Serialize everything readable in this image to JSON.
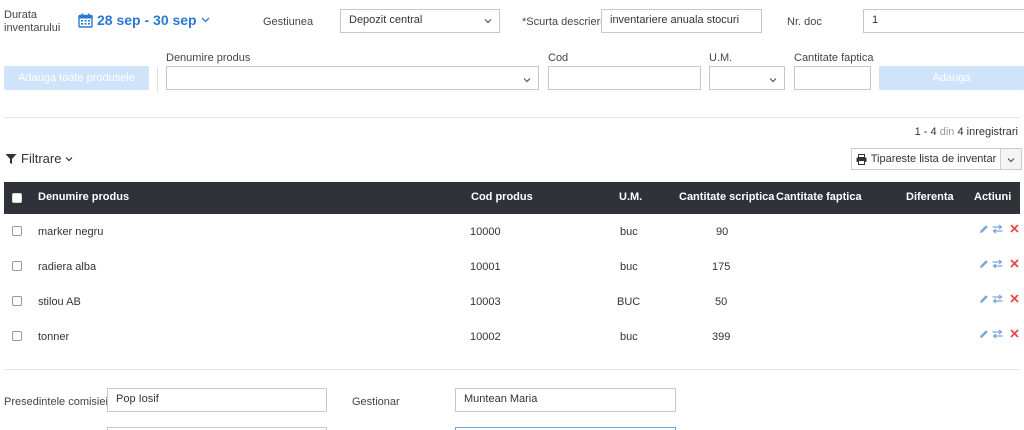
{
  "header": {
    "duration_label_1": "Durata",
    "duration_label_2": "inventarului",
    "date_range": "28 sep - 30 sep",
    "gestiunea_label": "Gestiunea",
    "gestiunea_value": "Depozit central",
    "descriere_label": "*Scurta descriere",
    "descriere_value": "inventariere anuala stocuri",
    "nrdoc_label": "Nr. doc",
    "nrdoc_value": "1"
  },
  "add_row": {
    "add_all_label": "Adauga toate produsele",
    "product_label": "Denumire produs",
    "product_value": "",
    "code_label": "Cod",
    "code_value": "",
    "um_label": "U.M.",
    "um_value": "",
    "qty_label": "Cantitate faptica",
    "qty_value": "",
    "add_label": "Adauga"
  },
  "pagination": {
    "range": "1 - 4",
    "din": "din",
    "total": "4",
    "suffix": "inregistrari"
  },
  "filter": {
    "label": "Filtrare"
  },
  "print": {
    "label": "Tipareste lista de inventar"
  },
  "table": {
    "headers": {
      "name": "Denumire produs",
      "code": "Cod produs",
      "um": "U.M.",
      "scriptic": "Cantitate scriptica",
      "faptic": "Cantitate faptica",
      "diff": "Diferenta",
      "actions": "Actiuni"
    },
    "rows": [
      {
        "name": "marker negru",
        "code": "10000",
        "um": "buc",
        "scriptic": "90",
        "faptic": "",
        "diff": ""
      },
      {
        "name": "radiera alba",
        "code": "10001",
        "um": "buc",
        "scriptic": "175",
        "faptic": "",
        "diff": ""
      },
      {
        "name": "stilou AB",
        "code": "10003",
        "um": "BUC",
        "scriptic": "50",
        "faptic": "",
        "diff": ""
      },
      {
        "name": "tonner",
        "code": "10002",
        "um": "buc",
        "scriptic": "399",
        "faptic": "",
        "diff": ""
      }
    ]
  },
  "footer": {
    "presedinte_label": "Presedintele comisiei",
    "presedinte_value": "Pop Iosif",
    "gestionar_label": "Gestionar",
    "gestionar_value": "Muntean Maria"
  },
  "colors": {
    "accent": "#2c78d6",
    "header_bg": "#2f3238",
    "disabled_btn": "#cfe3fb",
    "edit_icon": "#7aa7d8",
    "delete_icon": "#e24b4b"
  }
}
